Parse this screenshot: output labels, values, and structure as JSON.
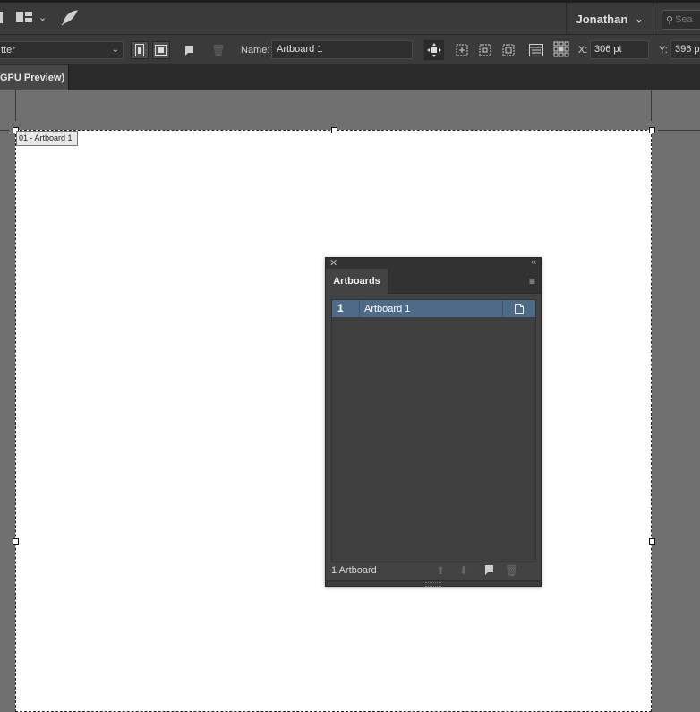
{
  "appbar": {
    "user_name": "Jonathan",
    "search_placeholder": "Sea",
    "icons": [
      "workspace-switcher-icon",
      "chevron-down-icon",
      "feather-icon",
      "search-icon"
    ]
  },
  "control_bar": {
    "preset_value": "tter",
    "name_label": "Name:",
    "artboard_name": "Artboard 1",
    "x_label": "X:",
    "x_value": "306 pt",
    "y_label": "Y:",
    "y_value": "396 p"
  },
  "document_tab": {
    "label": "GPU Preview)"
  },
  "canvas": {
    "artboard_label": "01 - Artboard 1"
  },
  "artboards_panel": {
    "title": "Artboards",
    "rows": [
      {
        "number": "1",
        "name": "Artboard 1"
      }
    ],
    "footer_count": "1 Artboard"
  }
}
